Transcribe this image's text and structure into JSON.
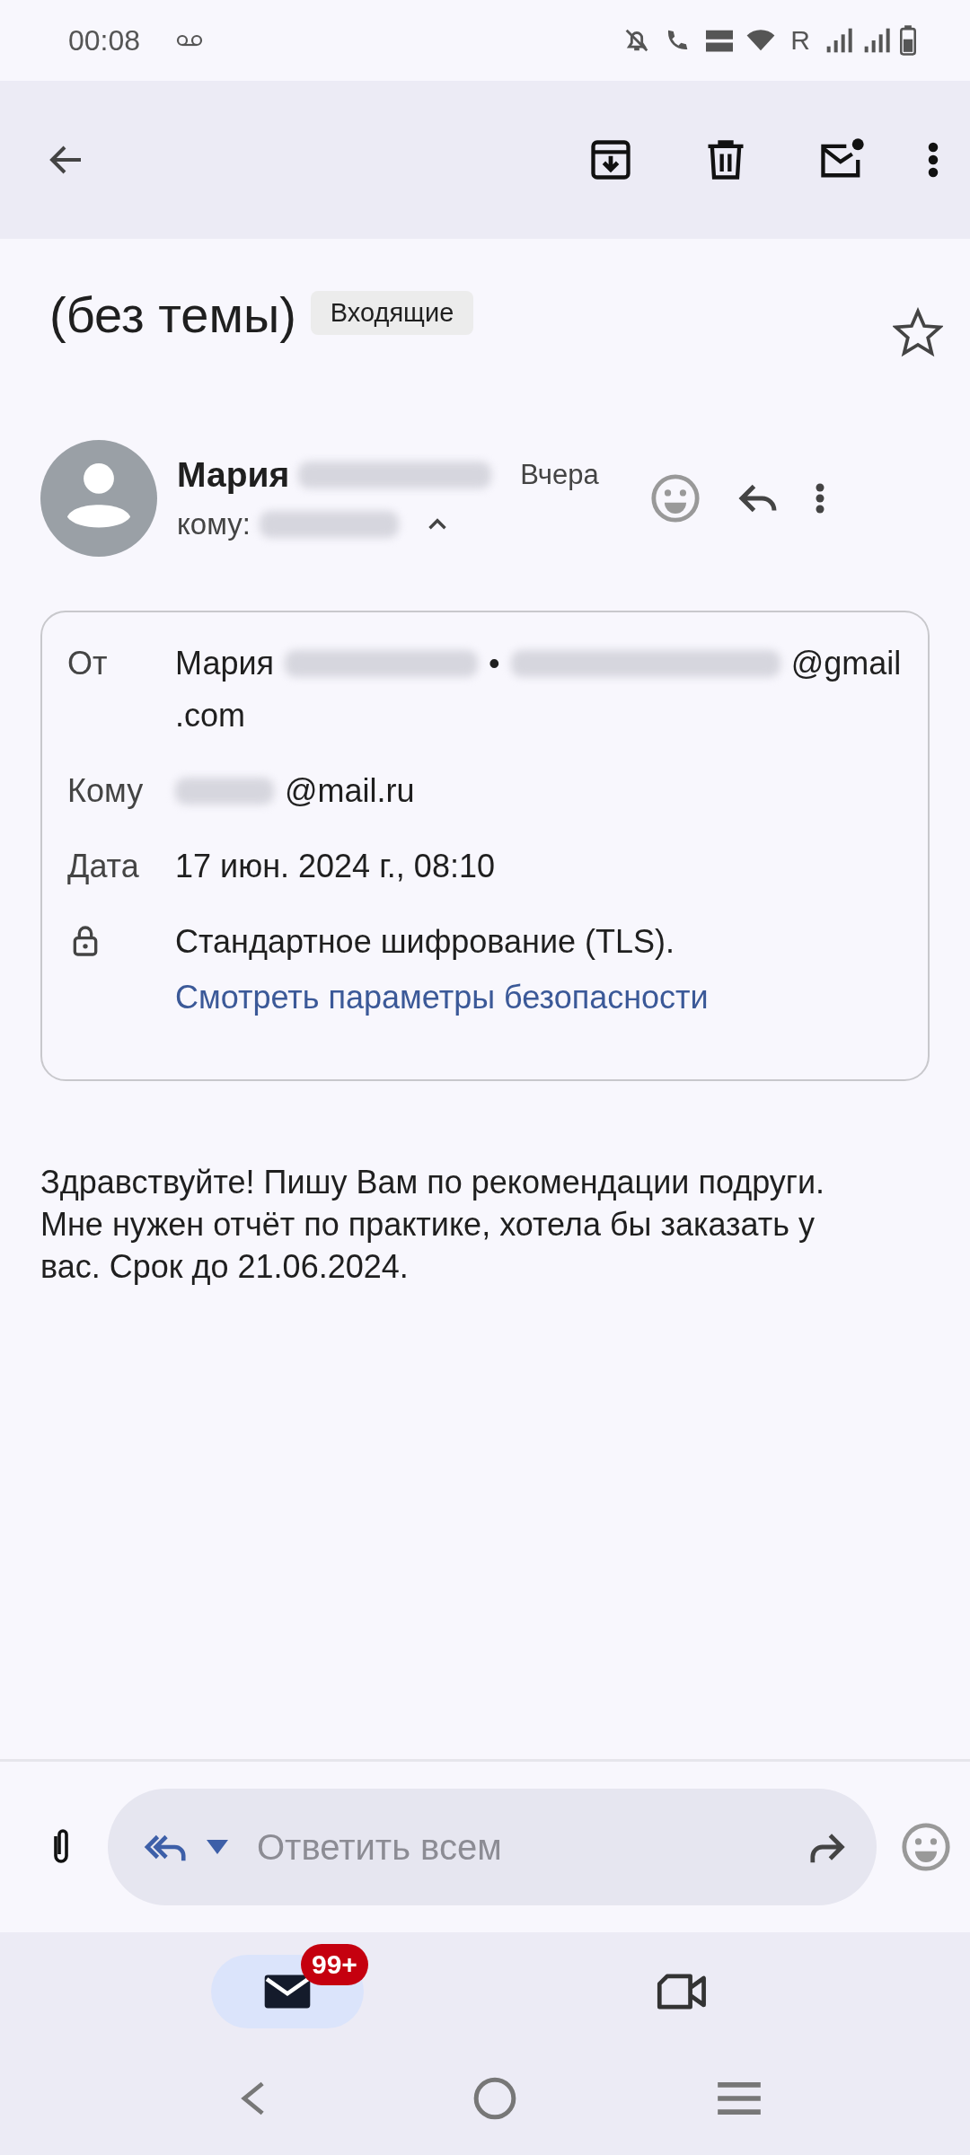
{
  "status_bar": {
    "time": "00:08",
    "roaming": "R"
  },
  "subject": {
    "title": "(без темы)",
    "label": "Входящие",
    "starred": false
  },
  "message": {
    "sender_first": "Мария",
    "time": "Вчера",
    "to_label": "кому:",
    "expanded": true
  },
  "details": [
    {
      "label": "От",
      "lines": [
        [
          {
            "kind": "text",
            "text": "Мария"
          },
          {
            "kind": "blurred"
          },
          {
            "kind": "text",
            "text": "•"
          },
          {
            "kind": "blurred"
          },
          {
            "kind": "text",
            "text": "@gmail"
          }
        ],
        [
          {
            "kind": "text",
            "text": ".com"
          }
        ]
      ]
    },
    {
      "label": "Кому",
      "lines": [
        [
          {
            "kind": "blurred"
          },
          {
            "kind": "text",
            "text": "@mail.ru"
          }
        ]
      ]
    },
    {
      "label": "Дата",
      "lines": [
        [
          {
            "kind": "text",
            "text": "17 июн. 2024 г., 08:10"
          }
        ]
      ]
    }
  ],
  "security": {
    "text": "Стандартное шифрование (TLS).",
    "link": "Смотреть параметры безопасности"
  },
  "body": "Здравствуйте! Пишу Вам по рекомендации подруги. Мне нужен отчёт по практике, хотела бы заказать у вас. Срок до 21.06.2024.",
  "reply_bar": {
    "placeholder": "Ответить всем"
  },
  "bottom_nav": [
    {
      "kind": "mail",
      "selected": true,
      "badge": "99+"
    },
    {
      "kind": "video",
      "selected": false
    }
  ]
}
